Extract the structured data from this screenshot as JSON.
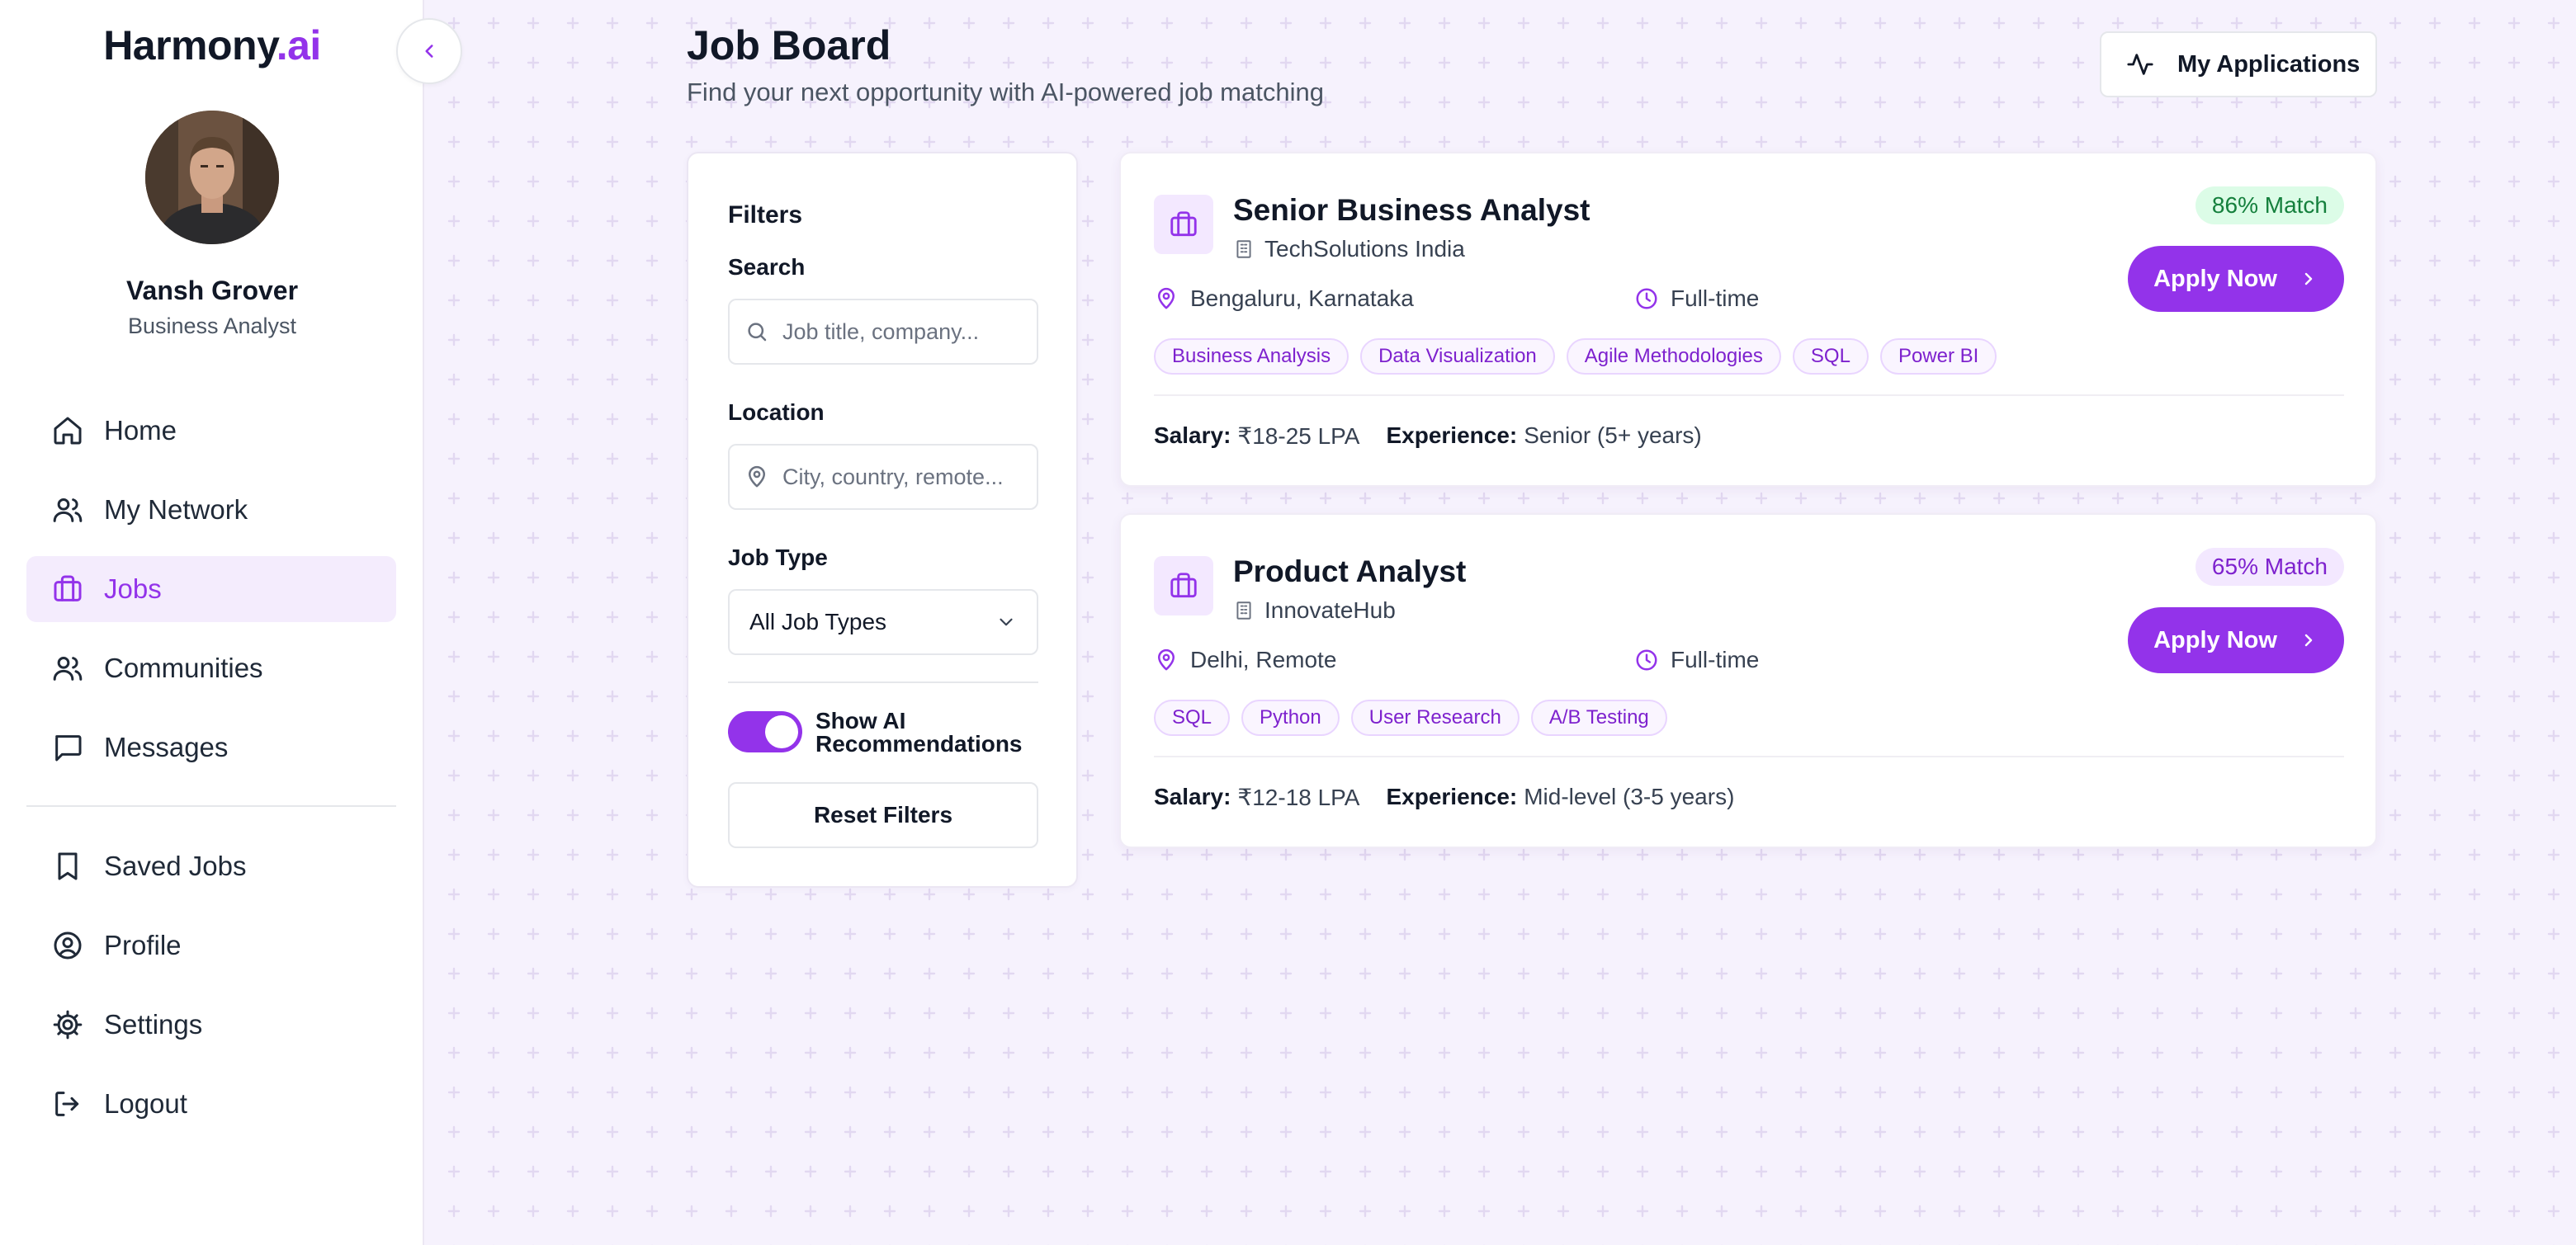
{
  "brand": {
    "name": "Harmony",
    "suffix": ".ai"
  },
  "profile": {
    "name": "Vansh Grover",
    "role": "Business Analyst"
  },
  "nav": {
    "home": "Home",
    "network": "My Network",
    "jobs": "Jobs",
    "communities": "Communities",
    "messages": "Messages",
    "saved_jobs": "Saved Jobs",
    "profile": "Profile",
    "settings": "Settings",
    "logout": "Logout",
    "active": "Jobs"
  },
  "header": {
    "title": "Job Board",
    "subtitle": "Find your next opportunity with AI-powered job matching",
    "applications_label": "My Applications"
  },
  "filters": {
    "heading": "Filters",
    "search_label": "Search",
    "search_placeholder": "Job title, company...",
    "location_label": "Location",
    "location_placeholder": "City, country, remote...",
    "job_type_label": "Job Type",
    "job_type_value": "All Job Types",
    "ai_toggle_label": "Show AI Recommendations",
    "ai_toggle_on": true,
    "reset_label": "Reset Filters"
  },
  "jobs": [
    {
      "title": "Senior Business Analyst",
      "company": "TechSolutions India",
      "location": "Bengaluru, Karnataka",
      "type": "Full-time",
      "match": "86% Match",
      "apply_label": "Apply Now",
      "tags": [
        "Business Analysis",
        "Data Visualization",
        "Agile Methodologies",
        "SQL",
        "Power BI"
      ],
      "salary_label": "Salary:",
      "salary": "₹18-25 LPA",
      "experience_label": "Experience:",
      "experience": "Senior (5+ years)"
    },
    {
      "title": "Product Analyst",
      "company": "InnovateHub",
      "location": "Delhi, Remote",
      "type": "Full-time",
      "match": "65% Match",
      "apply_label": "Apply Now",
      "tags": [
        "SQL",
        "Python",
        "User Research",
        "A/B Testing"
      ],
      "salary_label": "Salary:",
      "salary": "₹12-18 LPA",
      "experience_label": "Experience:",
      "experience": "Mid-level (3-5 years)"
    }
  ],
  "colors": {
    "accent": "#9333ea",
    "match_high": "#15803d",
    "match_mid": "#7e22ce",
    "background": "#f6f2fd"
  }
}
